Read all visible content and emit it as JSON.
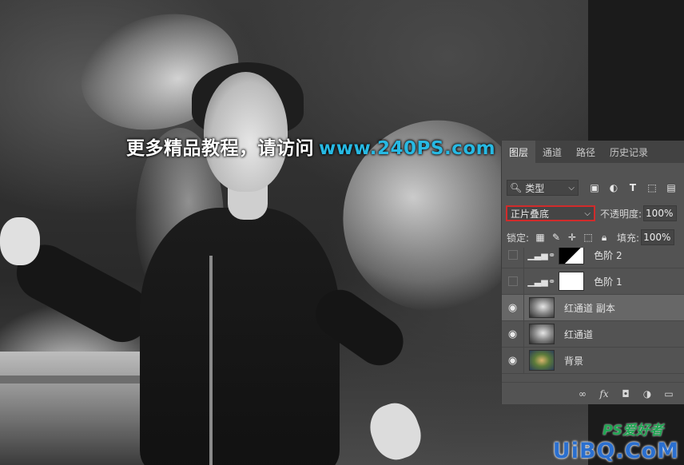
{
  "watermark": {
    "text": "更多精品教程，请访问",
    "url": "www.240PS.com"
  },
  "corner_logo": {
    "sub": "PS爱好者",
    "main": "UiBQ.CoM"
  },
  "layers_panel": {
    "tabs": [
      {
        "label": "图层",
        "active": true
      },
      {
        "label": "通道",
        "active": false
      },
      {
        "label": "路径",
        "active": false
      },
      {
        "label": "历史记录",
        "active": false
      }
    ],
    "filter": {
      "label": "类型",
      "icons": [
        "image-filter-icon",
        "adjustment-filter-icon",
        "type-filter-icon",
        "shape-filter-icon",
        "smart-object-filter-icon"
      ]
    },
    "blend_mode": "正片叠底",
    "opacity_label": "不透明度:",
    "opacity_value": "100%",
    "lock_label": "锁定:",
    "fill_label": "填充:",
    "fill_value": "100%",
    "layers": [
      {
        "name": "色阶 2",
        "visible": false,
        "type": "adjustment",
        "mask": "dark"
      },
      {
        "name": "色阶 1",
        "visible": false,
        "type": "adjustment",
        "mask": "white"
      },
      {
        "name": "红通道 副本",
        "visible": true,
        "type": "image",
        "thumb": "gray",
        "selected": true
      },
      {
        "name": "红通道",
        "visible": true,
        "type": "image",
        "thumb": "gray",
        "selected": false
      },
      {
        "name": "背景",
        "visible": true,
        "type": "image",
        "thumb": "color",
        "selected": false
      }
    ],
    "footer_icons": [
      "link-layers-icon",
      "fx-icon",
      "add-mask-icon",
      "new-adjustment-icon",
      "new-group-icon"
    ]
  }
}
